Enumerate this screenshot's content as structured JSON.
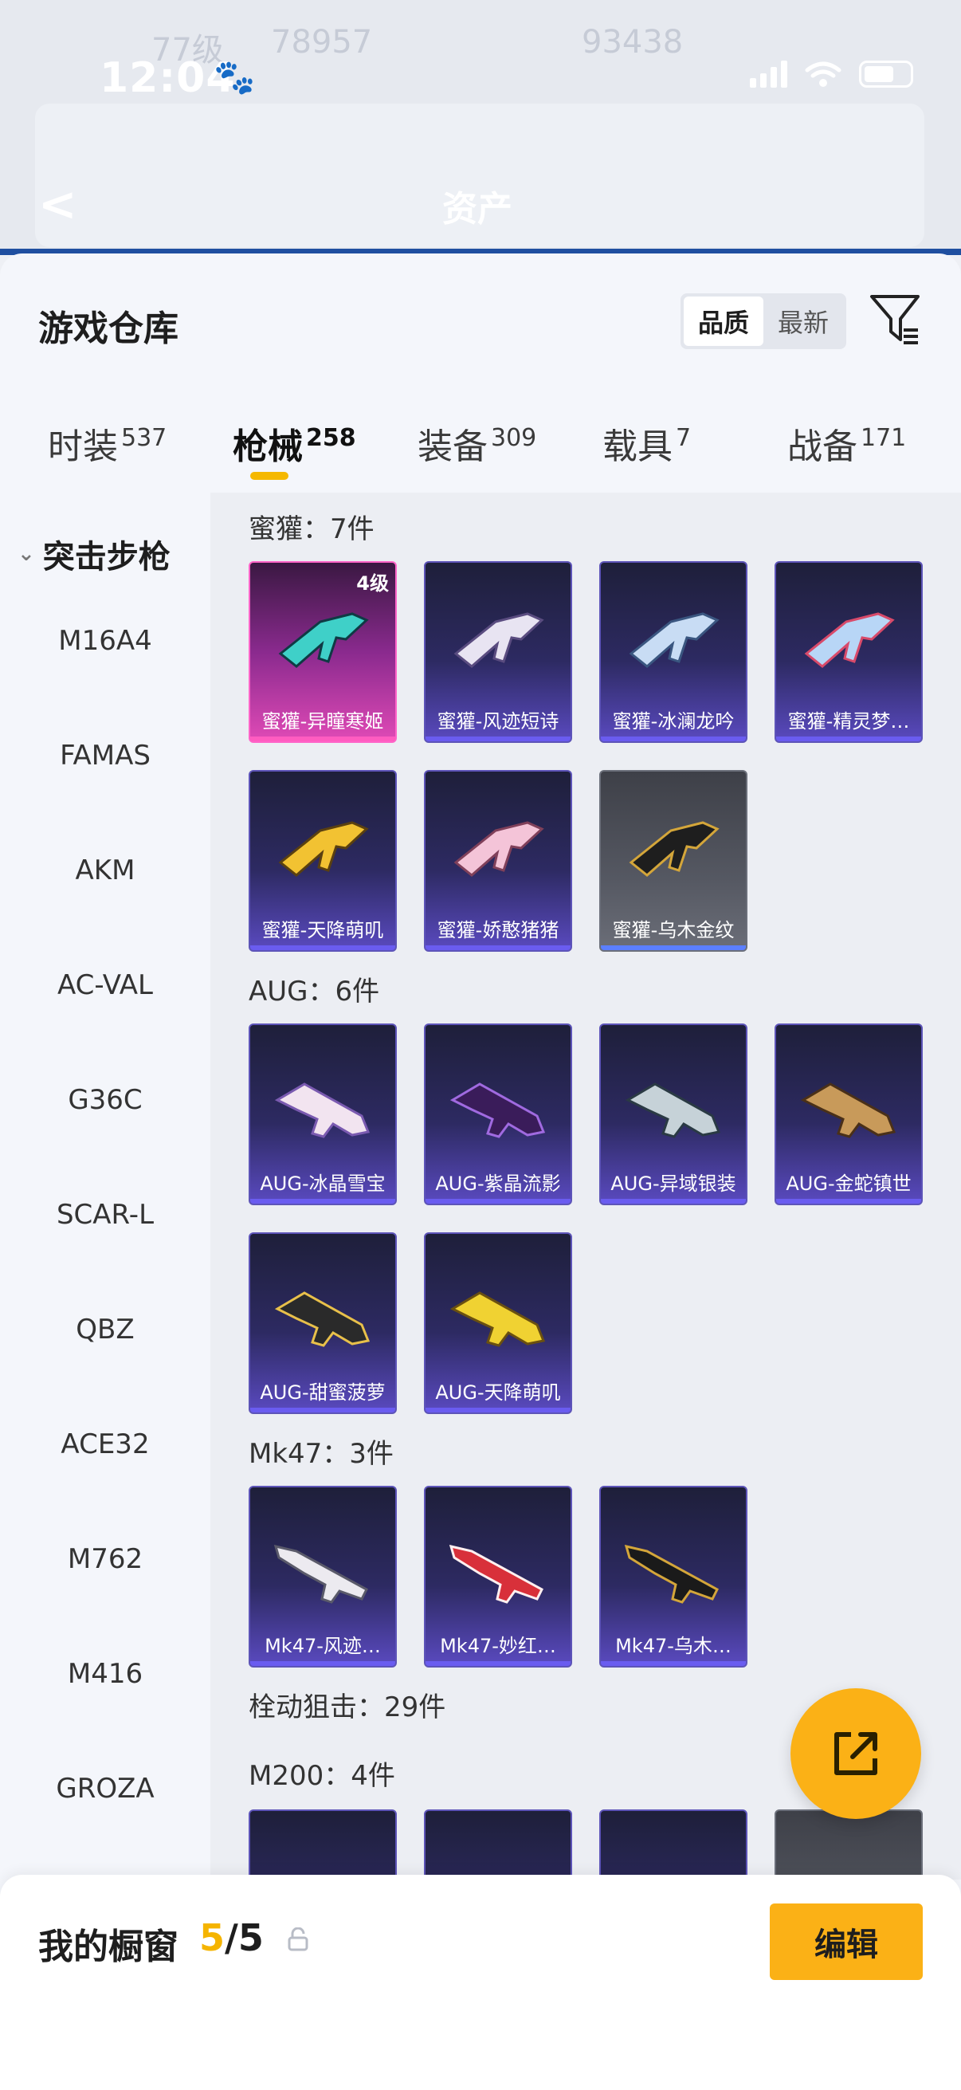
{
  "status": {
    "time": "12:04"
  },
  "background": {
    "level_text": "77级",
    "stat1": "78957",
    "stat2": "93438",
    "title": "资产"
  },
  "sheet": {
    "title": "游戏仓库",
    "sort_options": [
      "品质",
      "最新"
    ],
    "tabs": [
      {
        "label": "时装",
        "count": "537"
      },
      {
        "label": "枪械",
        "count": "258"
      },
      {
        "label": "装备",
        "count": "309"
      },
      {
        "label": "载具",
        "count": "7"
      },
      {
        "label": "战备",
        "count": "171"
      }
    ]
  },
  "sidebar": {
    "category": "突击步枪",
    "items": [
      "M16A4",
      "FAMAS",
      "AKM",
      "AC-VAL",
      "G36C",
      "SCAR-L",
      "QBZ",
      "ACE32",
      "M762",
      "M416",
      "GROZA"
    ]
  },
  "groups": {
    "g1_label": "蜜獾：7件",
    "g2_label": "AUG：6件",
    "g3_label": "Mk47：3件",
    "g4_label": "栓动狙击：29件",
    "g5_label": "M200：4件"
  },
  "items": {
    "honey": [
      "蜜獾-异瞳寒姬",
      "蜜獾-风迹短诗",
      "蜜獾-冰澜龙吟",
      "蜜獾-精灵梦…",
      "蜜獾-天降萌叽",
      "蜜獾-娇憨猪猪",
      "蜜獾-乌木金纹"
    ],
    "honey_level": "4级",
    "aug": [
      "AUG-冰晶雪宝",
      "AUG-紫晶流影",
      "AUG-异域银装",
      "AUG-金蛇镇世",
      "AUG-甜蜜菠萝",
      "AUG-天降萌叽"
    ],
    "mk47": [
      "Mk47-风迹…",
      "Mk47-妙红…",
      "Mk47-乌木…"
    ]
  },
  "bottom": {
    "label": "我的橱窗",
    "current": "5",
    "total": "/5",
    "edit": "编辑"
  },
  "colors": {
    "accent": "#fbb116",
    "purple_card": "#2d2a62",
    "pink_card": "#e04ab6"
  }
}
